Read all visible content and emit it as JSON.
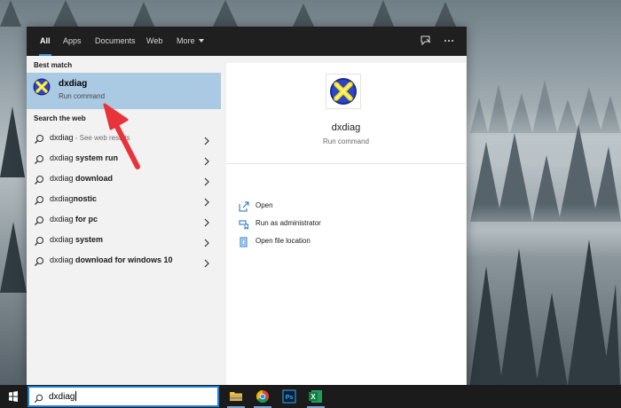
{
  "search_panel": {
    "filters": [
      {
        "label": "All"
      },
      {
        "label": "Apps"
      },
      {
        "label": "Documents"
      },
      {
        "label": "Web"
      },
      {
        "label": "More"
      }
    ],
    "best_match": {
      "section_label": "Best match",
      "title": "dxdiag",
      "subtitle": "Run command"
    },
    "web": {
      "section_label": "Search the web",
      "items": [
        {
          "prefix": "dxdiag",
          "bold": "",
          "hint": " - See web results"
        },
        {
          "prefix": "dxdiag ",
          "bold": "system run",
          "hint": ""
        },
        {
          "prefix": "dxdiag ",
          "bold": "download",
          "hint": ""
        },
        {
          "prefix": "dxdiag",
          "bold": "nostic",
          "hint": ""
        },
        {
          "prefix": "dxdiag ",
          "bold": "for pc",
          "hint": ""
        },
        {
          "prefix": "dxdiag ",
          "bold": "system",
          "hint": ""
        },
        {
          "prefix": "dxdiag ",
          "bold": "download for windows 10",
          "hint": ""
        }
      ]
    },
    "detail": {
      "title": "dxdiag",
      "subtitle": "Run command",
      "actions": [
        {
          "label": "Open",
          "icon": "open-icon"
        },
        {
          "label": "Run as administrator",
          "icon": "shield-icon"
        },
        {
          "label": "Open file location",
          "icon": "file-location-icon"
        }
      ]
    }
  },
  "taskbar": {
    "search_value": "dxdiag",
    "apps": [
      "file-explorer-icon",
      "chrome-icon",
      "photoshop-icon",
      "excel-icon"
    ],
    "photoshop_label": "Ps",
    "excel_label": "X"
  },
  "colors": {
    "accent": "#1e7fd6",
    "selection": "#aac9e2",
    "arrow": "#e8333a"
  }
}
